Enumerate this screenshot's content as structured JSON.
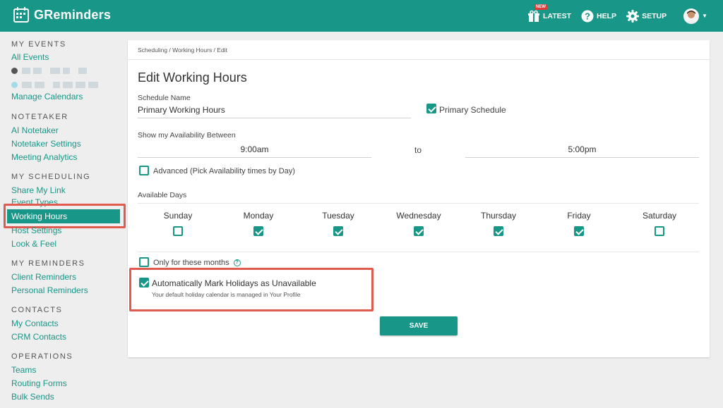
{
  "app": {
    "name": "GReminders"
  },
  "topnav": {
    "latest": "LATEST",
    "new_badge": "NEW",
    "help": "HELP",
    "setup": "SETUP"
  },
  "sidebar": {
    "my_events": {
      "title": "MY EVENTS",
      "all_events": "All Events",
      "manage_calendars": "Manage Calendars"
    },
    "notetaker": {
      "title": "NOTETAKER",
      "items": [
        "AI Notetaker",
        "Notetaker Settings",
        "Meeting Analytics"
      ]
    },
    "my_scheduling": {
      "title": "MY SCHEDULING",
      "items": [
        "Share My Link",
        "Event Types",
        "Working Hours",
        "Host Settings",
        "Look & Feel"
      ]
    },
    "my_reminders": {
      "title": "MY REMINDERS",
      "items": [
        "Client Reminders",
        "Personal Reminders"
      ]
    },
    "contacts": {
      "title": "CONTACTS",
      "items": [
        "My Contacts",
        "CRM Contacts"
      ]
    },
    "operations": {
      "title": "OPERATIONS",
      "items": [
        "Teams",
        "Routing Forms",
        "Bulk Sends"
      ]
    }
  },
  "main": {
    "breadcrumb": "Scheduling / Working Hours / Edit",
    "title": "Edit Working Hours",
    "schedule_name_label": "Schedule Name",
    "schedule_name_value": "Primary Working Hours",
    "primary_schedule": {
      "label": "Primary Schedule",
      "checked": true
    },
    "availability_label": "Show my Availability Between",
    "start_time": "9:00am",
    "to_label": "to",
    "end_time": "5:00pm",
    "advanced": {
      "label": "Advanced (Pick Availability times by Day)",
      "checked": false
    },
    "available_days_label": "Available Days",
    "days": [
      {
        "name": "Sunday",
        "checked": false
      },
      {
        "name": "Monday",
        "checked": true
      },
      {
        "name": "Tuesday",
        "checked": true
      },
      {
        "name": "Wednesday",
        "checked": true
      },
      {
        "name": "Thursday",
        "checked": true
      },
      {
        "name": "Friday",
        "checked": true
      },
      {
        "name": "Saturday",
        "checked": false
      }
    ],
    "only_months": {
      "label": "Only for these months",
      "help_icon": "?",
      "checked": false
    },
    "holidays": {
      "label": "Automatically Mark Holidays as Unavailable",
      "sub": "Your default holiday calendar is managed in Your Profile",
      "checked": true
    },
    "save_label": "SAVE"
  },
  "colors": {
    "brand": "#189688",
    "highlight": "#e15a50"
  }
}
